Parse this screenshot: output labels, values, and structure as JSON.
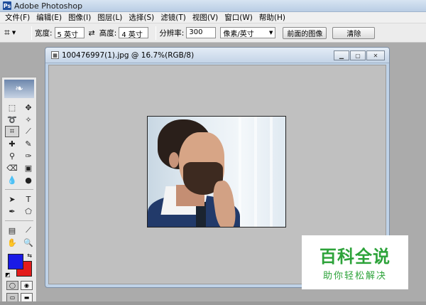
{
  "app": {
    "title": "Adobe Photoshop"
  },
  "menu": [
    "文件(F)",
    "编辑(E)",
    "图像(I)",
    "图层(L)",
    "选择(S)",
    "滤镜(T)",
    "视图(V)",
    "窗口(W)",
    "帮助(H)"
  ],
  "options": {
    "width_label": "宽度:",
    "width_value": "5 英寸",
    "height_label": "高度:",
    "height_value": "4 英寸",
    "resolution_label": "分辨率:",
    "resolution_value": "300",
    "unit_value": "像素/英寸",
    "front_image_button": "前面的图像",
    "clear_button": "清除"
  },
  "document": {
    "title": "100476997(1).jpg @ 16.7%(RGB/8)"
  },
  "colors": {
    "foreground": "#1a1ae6",
    "background": "#e31b1b"
  },
  "watermark": {
    "main": "百科全说",
    "sub": "助你轻松解决"
  }
}
